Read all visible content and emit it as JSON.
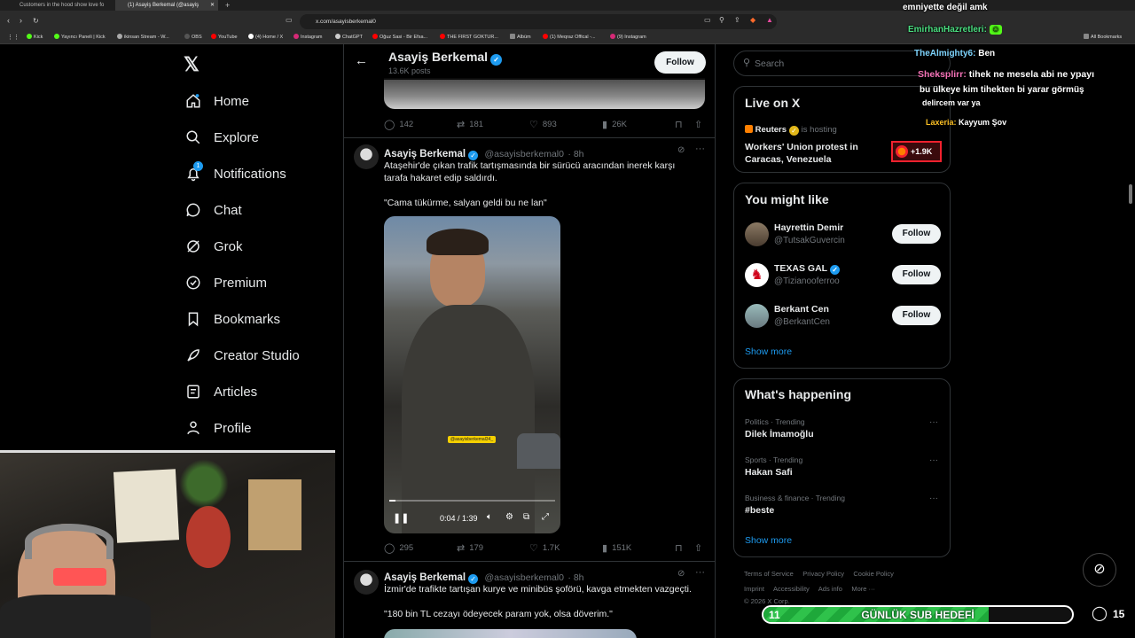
{
  "browser": {
    "tabs": [
      {
        "title": "Customers in the hood show love fo"
      },
      {
        "title": "(1) Asayiş Berkemal (@asayiş"
      }
    ],
    "url": "x.com/asayisberkemal0",
    "bookmarks": [
      "Kick",
      "Yayıncı Paneli | Kick",
      "ikinsan Stream - W...",
      "OBS",
      "YouTube",
      "(4) Home / X",
      "Instagram",
      "ChatGPT",
      "Oğuz Sasi - Bir Efsa...",
      "THE FIRST GOKTUR...",
      "Albüm",
      "(1) Meqraz Offical -...",
      "(9) Instagram"
    ],
    "all_bookmarks": "All Bookmarks"
  },
  "sidebar": {
    "logo": "X",
    "items": [
      {
        "label": "Home",
        "icon": "home-icon"
      },
      {
        "label": "Explore",
        "icon": "search-icon"
      },
      {
        "label": "Notifications",
        "icon": "bell-icon",
        "badge": "1"
      },
      {
        "label": "Chat",
        "icon": "chat-icon"
      },
      {
        "label": "Grok",
        "icon": "grok-icon"
      },
      {
        "label": "Premium",
        "icon": "premium-icon"
      },
      {
        "label": "Bookmarks",
        "icon": "bookmark-icon"
      },
      {
        "label": "Creator Studio",
        "icon": "rocket-icon"
      },
      {
        "label": "Articles",
        "icon": "articles-icon"
      },
      {
        "label": "Profile",
        "icon": "person-icon"
      }
    ]
  },
  "profile_header": {
    "name": "Asayiş Berkemal",
    "posts": "13.6K posts",
    "follow_label": "Follow"
  },
  "tweet0": {
    "replies": "142",
    "reposts": "181",
    "likes": "893",
    "views": "26K"
  },
  "tweet1": {
    "name": "Asayiş Berkemal",
    "handle": "@asayisberkemal0",
    "time": "· 8h",
    "text1": "Ataşehir'de çıkan trafik tartışmasında bir sürücü aracından inerek karşı tarafa hakaret edip saldırdı.",
    "text2": "\"Cama tükürme, salyan geldi bu ne lan\"",
    "video_tag": "@asayisberkemal34_",
    "video_time": "0:04 / 1:39",
    "video_progress": 0.04,
    "replies": "295",
    "reposts": "179",
    "likes": "1.7K",
    "views": "151K"
  },
  "tweet2": {
    "name": "Asayiş Berkemal",
    "handle": "@asayisberkemal0",
    "time": "· 8h",
    "text1": "İzmir'de trafikte tartışan kurye ve minibüs şoförü, kavga etmekten vazgeçti.",
    "text2": "\"180 bin TL cezayı ödeyecek param yok, olsa döverim.\""
  },
  "search": {
    "placeholder": "Search"
  },
  "live": {
    "title": "Live on X",
    "host": "Reuters",
    "hosting": "is hosting",
    "event": "Workers' Union protest in Caracas, Venezuela",
    "listeners": "+1.9K"
  },
  "might_like": {
    "title": "You might like",
    "users": [
      {
        "name": "Hayrettin Demir",
        "handle": "@TutsakGuvercin",
        "verified": false
      },
      {
        "name": "TEXAS GAL",
        "handle": "@Tizianooferroo",
        "verified": true
      },
      {
        "name": "Berkant Cen",
        "handle": "@BerkantCen",
        "verified": false
      }
    ],
    "follow_label": "Follow",
    "show_more": "Show more"
  },
  "happening": {
    "title": "What's happening",
    "trends": [
      {
        "category": "Politics · Trending",
        "name": "Dilek İmamoğlu"
      },
      {
        "category": "Sports · Trending",
        "name": "Hakan Safi"
      },
      {
        "category": "Business & finance · Trending",
        "name": "#beste"
      }
    ],
    "show_more": "Show more"
  },
  "footer": {
    "links": [
      "Terms of Service",
      "Privacy Policy",
      "Cookie Policy",
      "Imprint",
      "Accessibility",
      "Ads info",
      "More ···"
    ],
    "copyright": "© 2026 X Corp."
  },
  "chat": [
    {
      "user": "",
      "message": "emniyette değil amk"
    },
    {
      "user": "EmirhanHazretleri:",
      "message": ""
    },
    {
      "user": "TheAlmighty6:",
      "message": "Ben"
    },
    {
      "user": "Sheksplirr:",
      "message": "tihek ne mesela abi ne ypayı"
    },
    {
      "user": "",
      "message": "bu ülkeye kim tihekten bi yarar görmüş"
    },
    {
      "user": "",
      "message": "delircem var ya"
    },
    {
      "user": "Laxeria:",
      "message": "Kayyum Şov"
    }
  ],
  "subgoal": {
    "current": "11",
    "label": "GÜNLÜK SUB HEDEFİ",
    "target": "15",
    "progress": 0.73
  },
  "colors": {
    "accent": "#1d9bf0",
    "bg": "#000000",
    "border": "#2f3336",
    "goal_green": "#2fc24b"
  }
}
